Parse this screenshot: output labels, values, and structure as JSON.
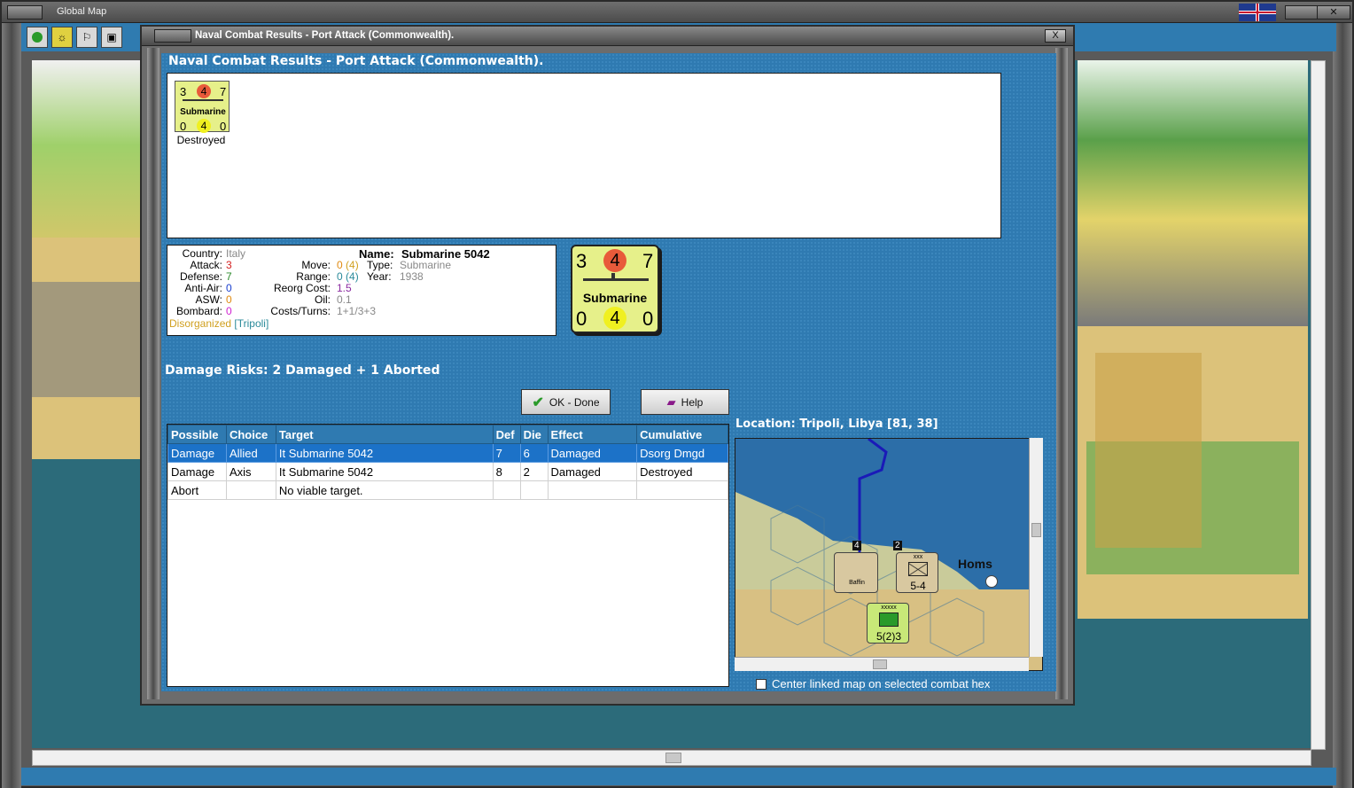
{
  "global_map": {
    "title": "Global Map",
    "toolbar": [
      "green-circle-icon",
      "sun-icon",
      "flag-icon",
      "grid-icon"
    ]
  },
  "dialog": {
    "title": "Naval Combat Results - Port Attack (Commonwealth).",
    "header": "Naval Combat Results - Port Attack (Commonwealth).",
    "close_label": "X"
  },
  "units": [
    {
      "attack": "3",
      "ind": "4",
      "def": "7",
      "type": "Submarine",
      "b1": "0",
      "b2": "4",
      "b3": "0",
      "status": "Destroyed"
    }
  ],
  "info": {
    "country_label": "Country:",
    "country": "Italy",
    "attack_label": "Attack:",
    "attack": "3",
    "defense_label": "Defense:",
    "defense": "7",
    "antiair_label": "Anti-Air:",
    "antiair": "0",
    "asw_label": "ASW:",
    "asw": "0",
    "bombard_label": "Bombard:",
    "bombard": "0",
    "name_label": "Name:",
    "name": "Submarine 5042",
    "move_label": "Move:",
    "move": "0",
    "move_max": "(4)",
    "type_label": "Type:",
    "type": "Submarine",
    "range_label": "Range:",
    "range": "0",
    "range_max": "(4)",
    "year_label": "Year:",
    "year": "1938",
    "reorg_label": "Reorg Cost:",
    "reorg": "1.5",
    "oil_label": "Oil:",
    "oil": "0.1",
    "costs_label": "Costs/Turns:",
    "costs": "1+1/3+3",
    "status": "Disorganized",
    "location": "[Tripoli]"
  },
  "big_counter": {
    "attack": "3",
    "ind": "4",
    "def": "7",
    "type": "Submarine",
    "b1": "0",
    "b2": "4",
    "b3": "0"
  },
  "damage_risks": {
    "label": "Damage Risks:",
    "value": "2 Damaged + 1 Aborted"
  },
  "buttons": {
    "ok": "OK - Done",
    "help": "Help"
  },
  "table": {
    "columns": [
      "Possible",
      "Choice",
      "Target",
      "Def",
      "Die",
      "Effect",
      "Cumulative"
    ],
    "rows": [
      [
        "Damage",
        "Allied",
        "It Submarine 5042",
        "7",
        "6",
        "Damaged",
        "Dsorg Dmgd"
      ],
      [
        "Damage",
        "Axis",
        "It Submarine 5042",
        "8",
        "2",
        "Damaged",
        "Destroyed"
      ],
      [
        "Abort",
        "",
        "No viable target.",
        "",
        "",
        "",
        ""
      ]
    ]
  },
  "location": {
    "label": "Location:",
    "value": "Tripoli, Libya [81, 38]",
    "town": "Homs",
    "units": [
      {
        "name": "Baffin",
        "top": "4"
      },
      {
        "name": "5-4",
        "top": "2",
        "size": "xxx"
      },
      {
        "name": "5(2)3",
        "size": "xxxxx"
      }
    ]
  },
  "center_checkbox": {
    "label": "Center linked map on selected combat hex",
    "checked": false
  }
}
